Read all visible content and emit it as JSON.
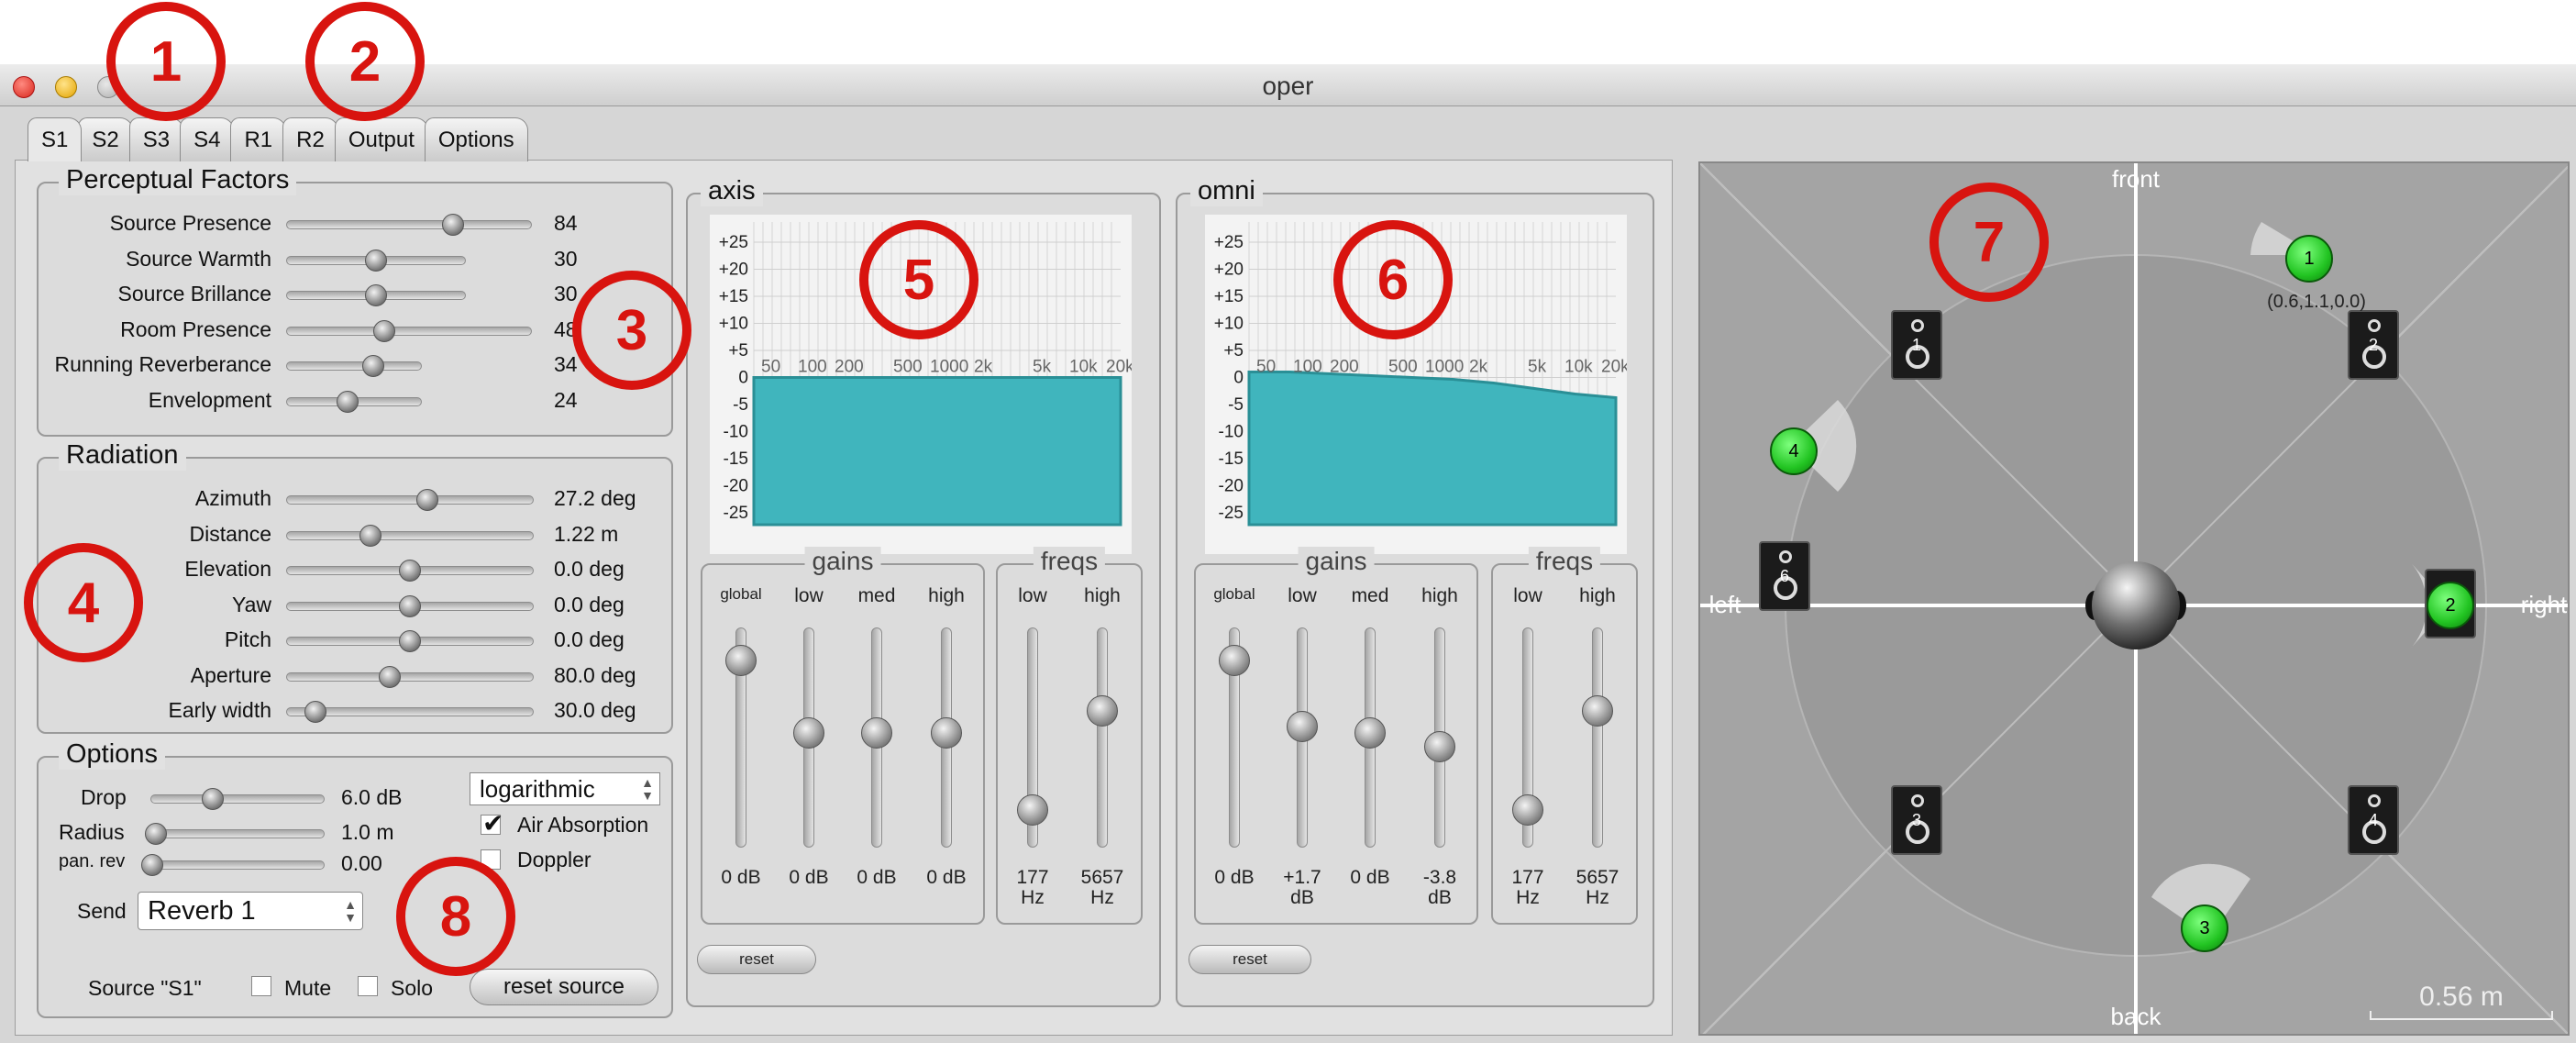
{
  "window": {
    "title": "oper"
  },
  "tabs": [
    "S1",
    "S2",
    "S3",
    "S4",
    "R1",
    "R2",
    "Output",
    "Options"
  ],
  "perceptual": {
    "title": "Perceptual Factors",
    "rows": [
      {
        "label": "Source Presence",
        "value": "84",
        "level": 0.68
      },
      {
        "label": "Source Warmth",
        "value": "30",
        "level": 0.5
      },
      {
        "label": "Source Brillance",
        "value": "30",
        "level": 0.5
      },
      {
        "label": "Room Presence",
        "value": "48",
        "level": 0.4
      },
      {
        "label": "Running Reverberance",
        "value": "34",
        "level": 0.64
      },
      {
        "label": "Envelopment",
        "value": "24",
        "level": 0.45
      }
    ]
  },
  "radiation": {
    "title": "Radiation",
    "rows": [
      {
        "label": "Azimuth",
        "value": "27.2 deg",
        "level": 0.57
      },
      {
        "label": "Distance",
        "value": "1.22 m",
        "level": 0.34
      },
      {
        "label": "Elevation",
        "value": "0.0 deg",
        "level": 0.5
      },
      {
        "label": "Yaw",
        "value": "0.0 deg",
        "level": 0.5
      },
      {
        "label": "Pitch",
        "value": "0.0 deg",
        "level": 0.5
      },
      {
        "label": "Aperture",
        "value": "80.0 deg",
        "level": 0.42
      },
      {
        "label": "Early width",
        "value": "30.0 deg",
        "level": 0.12
      }
    ]
  },
  "options": {
    "title": "Options",
    "drop": {
      "label": "Drop",
      "value": "6.0 dB",
      "level": 0.38
    },
    "radius": {
      "label": "Radius",
      "value": "1.0 m",
      "level": 0.04
    },
    "pan_rev": {
      "label": "pan. rev",
      "value": "0.00",
      "level": 0.02
    },
    "mode_select": "logarithmic",
    "air_absorption": {
      "label": "Air Absorption",
      "checked": true
    },
    "doppler": {
      "label": "Doppler",
      "checked": false
    },
    "send_label": "Send",
    "send_value": "Reverb 1",
    "source_label": "Source \"S1\"",
    "mute_label": "Mute",
    "solo_label": "Solo",
    "reset_source_label": "reset source"
  },
  "eq_axis_ticks": [
    "+25",
    "+20",
    "+15",
    "+10",
    "+5",
    "0",
    "-5",
    "-10",
    "-15",
    "-20",
    "-25"
  ],
  "eq_freq_ticks": [
    "50",
    "100",
    "200",
    "500",
    "1000",
    "2k",
    "5k",
    "10k",
    "20k"
  ],
  "axis": {
    "title": "axis",
    "gains_title": "gains",
    "freqs_title": "freqs",
    "gain_labels": [
      "global",
      "low",
      "med",
      "high"
    ],
    "gain_values": [
      "0 dB",
      "0 dB",
      "0 dB",
      "0 dB"
    ],
    "gain_levels": [
      0.85,
      0.52,
      0.52,
      0.52
    ],
    "freq_labels": [
      "low",
      "high"
    ],
    "freq_values": [
      "177\nHz",
      "5657\nHz"
    ],
    "freq_levels": [
      0.17,
      0.62
    ],
    "reset_label": "reset"
  },
  "omni": {
    "title": "omni",
    "gains_title": "gains",
    "freqs_title": "freqs",
    "gain_labels": [
      "global",
      "low",
      "med",
      "high"
    ],
    "gain_values": [
      "0 dB",
      "+1.7\ndB",
      "0 dB",
      "-3.8\ndB"
    ],
    "gain_levels": [
      0.85,
      0.55,
      0.52,
      0.46
    ],
    "freq_labels": [
      "low",
      "high"
    ],
    "freq_values": [
      "177\nHz",
      "5657\nHz"
    ],
    "freq_levels": [
      0.17,
      0.62
    ],
    "reset_label": "reset"
  },
  "spatial": {
    "front": "front",
    "back": "back",
    "left": "left",
    "right": "right",
    "scale": "0.56 m",
    "source1_coords": "(0.6,1.1,0.0)",
    "speakers": [
      "1",
      "2",
      "3",
      "4",
      "5",
      "6"
    ],
    "sources": [
      "1",
      "2",
      "3",
      "4"
    ]
  },
  "markers": [
    "1",
    "2",
    "3",
    "4",
    "5",
    "6",
    "7",
    "8"
  ],
  "colors": {
    "eq_fill": "#40b5bd",
    "source_green": "#22c422",
    "annotation_red": "#d8140f"
  }
}
